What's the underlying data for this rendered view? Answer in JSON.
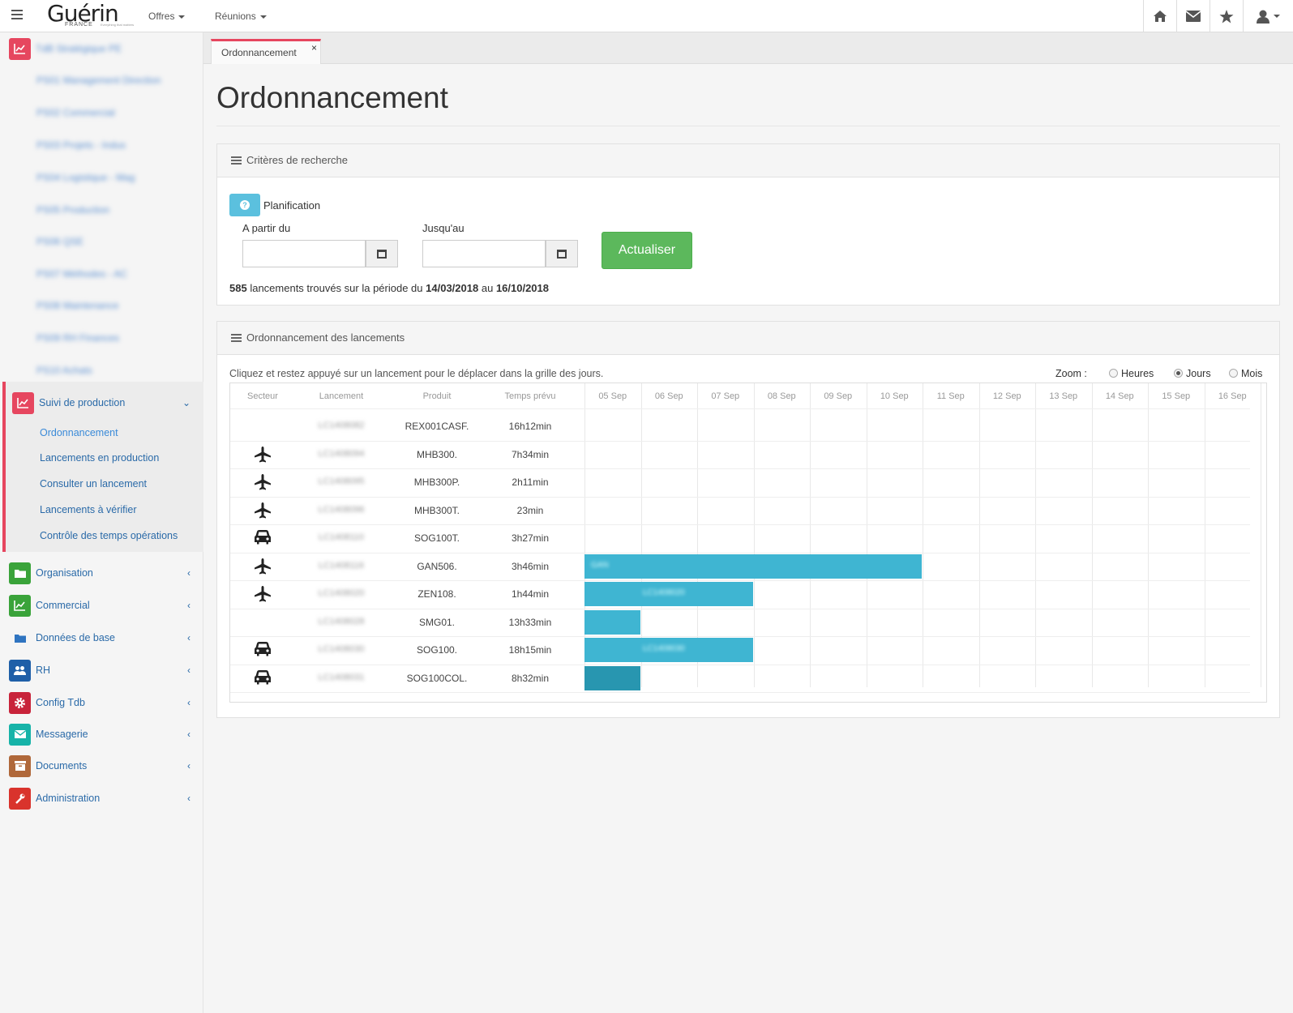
{
  "header": {
    "logo": "Guérin",
    "logo_sub": "FRANCE",
    "logo_tagline": "Everything that matters",
    "menu": [
      {
        "label": "Offres"
      },
      {
        "label": "Réunions"
      }
    ],
    "icons": [
      "home-icon",
      "envelope-icon",
      "star-icon",
      "user-icon"
    ]
  },
  "sidebar": {
    "top_section": {
      "label": "TdB Stratégique PE",
      "icon": "chart-icon",
      "color": "#e6465f"
    },
    "blurred_items": [
      "PS01 Management Direction",
      "PS02 Commercial",
      "PS03 Projets - Indus",
      "PS04 Logistique - Mag",
      "PS05 Production",
      "PS06 QSE",
      "PS07 Méthodes - AC",
      "PS08 Maintenance",
      "PS09 RH Finances",
      "PS10 Achats"
    ],
    "active_section": {
      "label": "Suivi de production",
      "icon": "chart-icon",
      "color": "#e6465f",
      "children": [
        {
          "label": "Ordonnancement",
          "active": true
        },
        {
          "label": "Lancements en production"
        },
        {
          "label": "Consulter un lancement"
        },
        {
          "label": "Lancements à vérifier"
        },
        {
          "label": "Contrôle des temps opérations"
        }
      ]
    },
    "sections": [
      {
        "label": "Organisation",
        "icon": "folder-icon",
        "color": "#3aa33a"
      },
      {
        "label": "Commercial",
        "icon": "chart-icon",
        "color": "#3aa33a"
      },
      {
        "label": "Données de base",
        "icon": "folder-icon",
        "color": "#2f74c0"
      },
      {
        "label": "RH",
        "icon": "users-icon",
        "color": "#1f5fa8"
      },
      {
        "label": "Config Tdb",
        "icon": "gear-icon",
        "color": "#c8233a"
      },
      {
        "label": "Messagerie",
        "icon": "envelope-icon",
        "color": "#17b3a8"
      },
      {
        "label": "Documents",
        "icon": "archive-icon",
        "color": "#b0683a"
      },
      {
        "label": "Administration",
        "icon": "wrench-icon",
        "color": "#d9332c"
      }
    ]
  },
  "tabs": [
    {
      "label": "Ordonnancement",
      "close": "×"
    }
  ],
  "page": {
    "title": "Ordonnancement"
  },
  "criteria": {
    "panel_title": "Critères de recherche",
    "planification_label": "Planification",
    "from_label": "A partir du",
    "to_label": "Jusqu'au",
    "from_value": "",
    "to_value": "",
    "refresh_button": "Actualiser",
    "summary": {
      "count": "585",
      "text1": "lancements trouvés sur la période du",
      "date_from": "14/03/2018",
      "text2": "au",
      "date_to": "16/10/2018"
    }
  },
  "schedule": {
    "panel_title": "Ordonnancement des lancements",
    "hint": "Cliquez et restez appuyé sur un lancement pour le déplacer dans la grille des jours.",
    "zoom_label": "Zoom :",
    "zoom_options": [
      {
        "label": "Heures",
        "selected": false
      },
      {
        "label": "Jours",
        "selected": true
      },
      {
        "label": "Mois",
        "selected": false
      }
    ],
    "columns": [
      "Secteur",
      "Lancement",
      "Produit",
      "Temps prévu"
    ],
    "days": [
      "05 Sep",
      "06 Sep",
      "07 Sep",
      "08 Sep",
      "09 Sep",
      "10 Sep",
      "11 Sep",
      "12 Sep",
      "13 Sep",
      "14 Sep",
      "15 Sep",
      "16 Sep"
    ],
    "rows": [
      {
        "sector": "",
        "launch": "LC1408082",
        "product": "REX001CASF.",
        "time": "16h12min",
        "bar": null
      },
      {
        "sector": "plane",
        "launch": "LC1408094",
        "product": "MHB300.",
        "time": "7h34min",
        "bar": null
      },
      {
        "sector": "plane",
        "launch": "LC1408095",
        "product": "MHB300P.",
        "time": "2h11min",
        "bar": null
      },
      {
        "sector": "plane",
        "launch": "LC1408096",
        "product": "MHB300T.",
        "time": "23min",
        "bar": null
      },
      {
        "sector": "car",
        "launch": "LC1408110",
        "product": "SOG100T.",
        "time": "3h27min",
        "bar": null
      },
      {
        "sector": "plane",
        "launch": "LC1408116",
        "product": "GAN506.",
        "time": "3h46min",
        "bar": {
          "start_day": 0,
          "days": 6,
          "label": "GAN",
          "style": "normal"
        }
      },
      {
        "sector": "plane",
        "launch": "LC1408020",
        "product": "ZEN108.",
        "time": "1h44min",
        "bar": {
          "start_day": 0,
          "days": 3,
          "label": "LC1408020",
          "style": "normal"
        }
      },
      {
        "sector": "",
        "launch": "LC1408028",
        "product": "SMG01.",
        "time": "13h33min",
        "bar": {
          "start_day": 0,
          "days": 1,
          "label": "",
          "style": "normal"
        }
      },
      {
        "sector": "car",
        "launch": "LC1408030",
        "product": "SOG100.",
        "time": "18h15min",
        "bar": {
          "start_day": 0,
          "days": 3,
          "label": "LC1408030",
          "style": "normal"
        }
      },
      {
        "sector": "car",
        "launch": "LC1408031",
        "product": "SOG100COL.",
        "time": "8h32min",
        "bar": {
          "start_day": 0,
          "days": 1,
          "label": "",
          "style": "dark"
        }
      }
    ]
  }
}
